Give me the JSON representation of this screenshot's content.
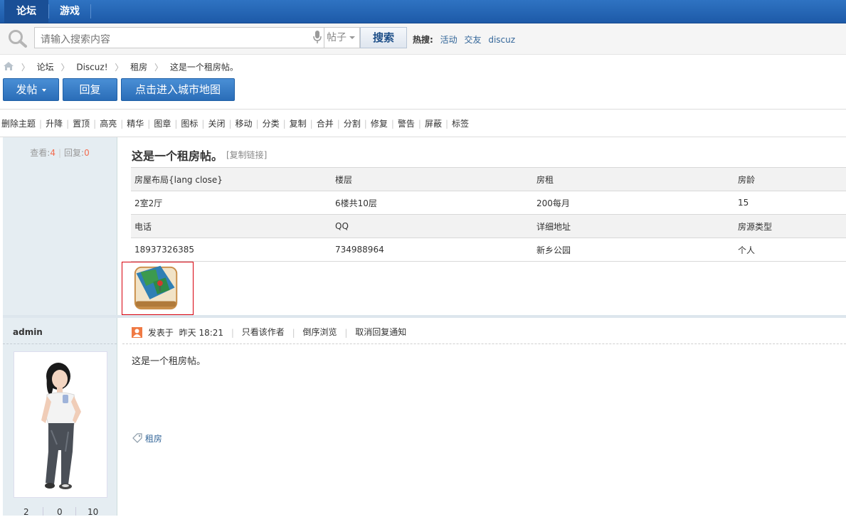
{
  "top_nav": {
    "tabs": [
      {
        "label": "论坛",
        "active": true
      },
      {
        "label": "游戏",
        "active": false
      }
    ]
  },
  "search": {
    "placeholder": "请输入搜索内容",
    "type_select": "帖子",
    "button": "搜索",
    "hot_label": "热搜:",
    "hot_items": [
      "活动",
      "交友",
      "discuz"
    ]
  },
  "breadcrumb": [
    "论坛",
    "Discuz!",
    "租房",
    "这是一个租房帖。"
  ],
  "actions": {
    "post": "发帖",
    "reply": "回复",
    "city_map": "点击进入城市地图"
  },
  "mod_tools": [
    "删除主题",
    "升降",
    "置顶",
    "高亮",
    "精华",
    "图章",
    "图标",
    "关闭",
    "移动",
    "分类",
    "复制",
    "合并",
    "分割",
    "修复",
    "警告",
    "屏蔽",
    "标签"
  ],
  "thread": {
    "view_label": "查看:",
    "views": "4",
    "reply_label": "回复:",
    "replies": "0",
    "title": "这是一个租房帖。",
    "copy_link": "[复制链接]"
  },
  "info_table": {
    "rows": [
      [
        "房屋布局{lang close}",
        "楼层",
        "房租",
        "房龄"
      ],
      [
        "2室2厅",
        "6楼共10层",
        "200每月",
        "15"
      ],
      [
        "电话",
        "QQ",
        "详细地址",
        "房源类型"
      ],
      [
        "18937326385",
        "734988964",
        "新乡公园",
        "个人"
      ]
    ]
  },
  "post": {
    "author": "admin",
    "posted_prefix": "发表于",
    "posted_time": "昨天 18:21",
    "only_author": "只看该作者",
    "reverse": "倒序浏览",
    "cancel_notify": "取消回复通知",
    "content": "这是一个租房帖。",
    "tag": "租房"
  },
  "user_stats": [
    "2",
    "0",
    "10"
  ],
  "colors": {
    "nav_blue": "#1d5aa8",
    "button_blue": "#2a6db8",
    "link": "#336699",
    "accent_red": "#f26c4f"
  }
}
